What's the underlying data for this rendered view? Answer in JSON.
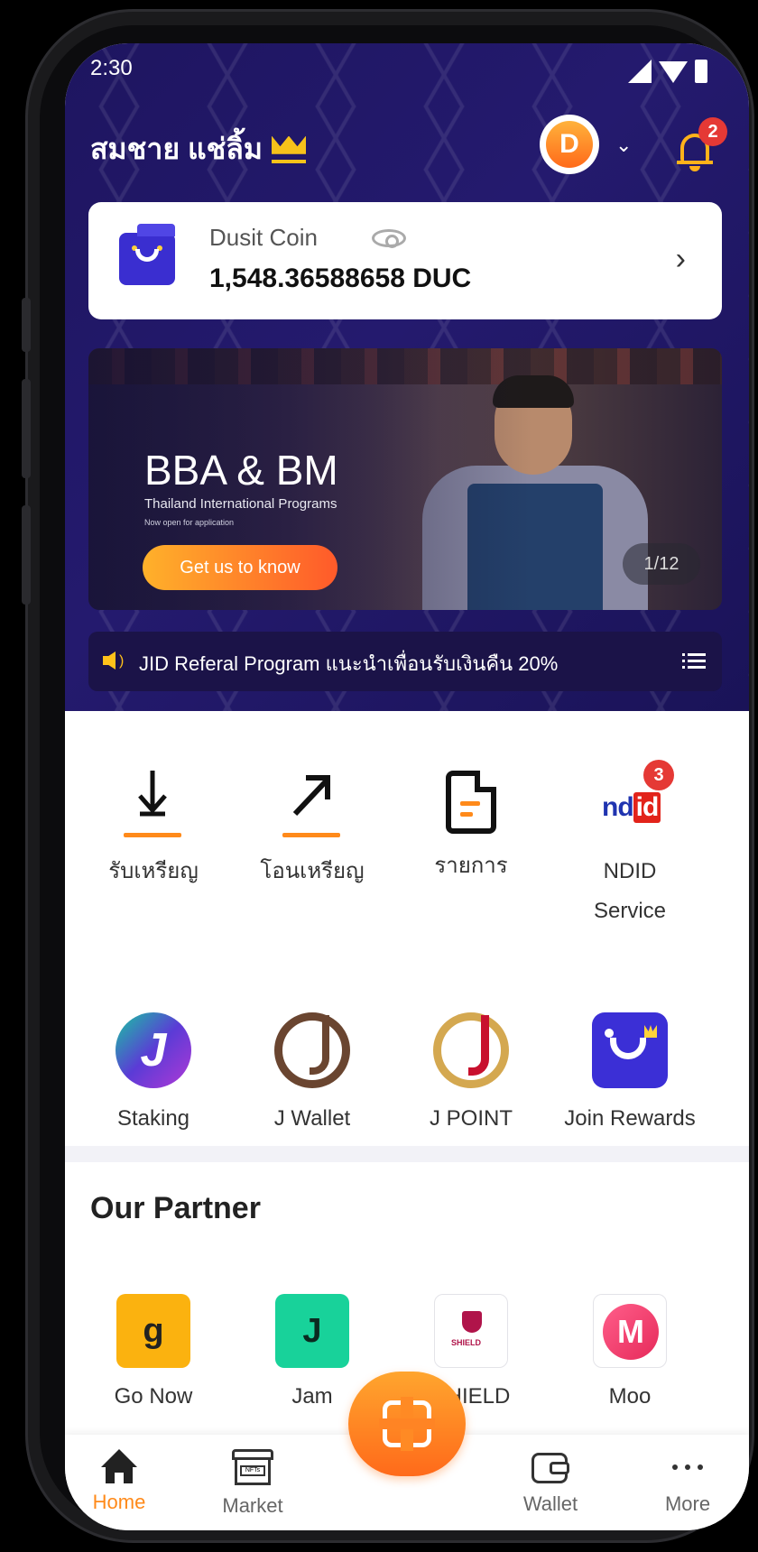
{
  "status_bar": {
    "time": "2:30"
  },
  "header": {
    "username": "สมชาย แช่ลิ้ม",
    "avatar_letter": "D",
    "notification_count": "2"
  },
  "coin_card": {
    "label": "Dusit Coin",
    "amount": "1,548.36588658 DUC"
  },
  "banner": {
    "title": "BBA & BM",
    "subtitle": "Thailand International Programs",
    "small_text": "Now open for application",
    "cta": "Get us to know",
    "pager": "1/12"
  },
  "ticker": {
    "text": "JID Referal Program แนะนำเพื่อนรับเงินคืน 20%"
  },
  "menu": [
    {
      "label": "รับเหรียญ",
      "icon": "receive-coin-icon"
    },
    {
      "label": "โอนเหรียญ",
      "icon": "transfer-coin-icon"
    },
    {
      "label": "รายการ",
      "icon": "transactions-icon"
    },
    {
      "label_line1": "NDID",
      "label_line2": "Service",
      "icon": "ndid-icon",
      "badge": "3"
    },
    {
      "label": "Staking",
      "icon": "staking-icon"
    },
    {
      "label": "J Wallet",
      "icon": "j-wallet-icon"
    },
    {
      "label": "J POINT",
      "icon": "j-point-icon"
    },
    {
      "label": "Join Rewards",
      "icon": "join-rewards-icon"
    }
  ],
  "partners": {
    "title": "Our Partner",
    "items": [
      {
        "label": "Go Now",
        "logo_letter": "g"
      },
      {
        "label": "Jam",
        "logo_letter": "J"
      },
      {
        "label": "SHIELD",
        "logo_text": "SHIELD"
      },
      {
        "label": "Moo",
        "logo_letter": "M"
      }
    ]
  },
  "tabbar": {
    "home": "Home",
    "market": "Market",
    "market_icon_text": "NFTs",
    "wallet": "Wallet",
    "more": "More"
  },
  "colors": {
    "header_bg": "#201664",
    "accent": "#ff8a1a",
    "badge": "#e53935"
  }
}
